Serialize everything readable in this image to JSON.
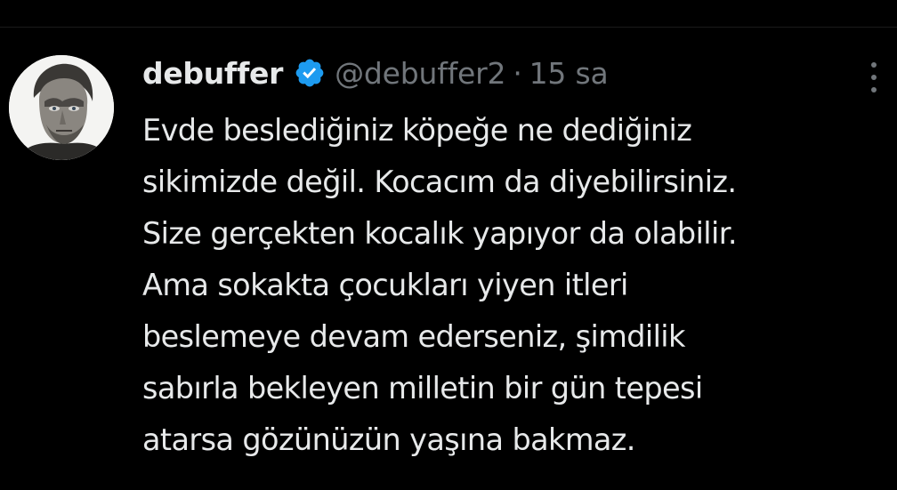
{
  "tweet": {
    "author": {
      "display_name": "debuffer",
      "handle": "@debuffer2",
      "verified": true
    },
    "separator": "·",
    "timestamp": "15 sa",
    "text_lines": [
      "Evde beslediğiniz köpeğe ne dediğiniz",
      "sikimizde değil. Kocacım da diyebilirsiniz.",
      "Size gerçekten kocalık yapıyor da olabilir.",
      "Ama sokakta çocukları yiyen itleri",
      "beslemeye devam ederseniz, şimdilik",
      "sabırla bekleyen milletin bir gün tepesi",
      "atarsa gözünüzün yaşına bakmaz."
    ]
  },
  "colors": {
    "background": "#000000",
    "text_primary": "#e7e9ea",
    "text_secondary": "#71767b",
    "verified_badge": "#1d9bf0"
  },
  "icons": {
    "verified": "verified-badge-icon",
    "more": "more-options-icon"
  }
}
